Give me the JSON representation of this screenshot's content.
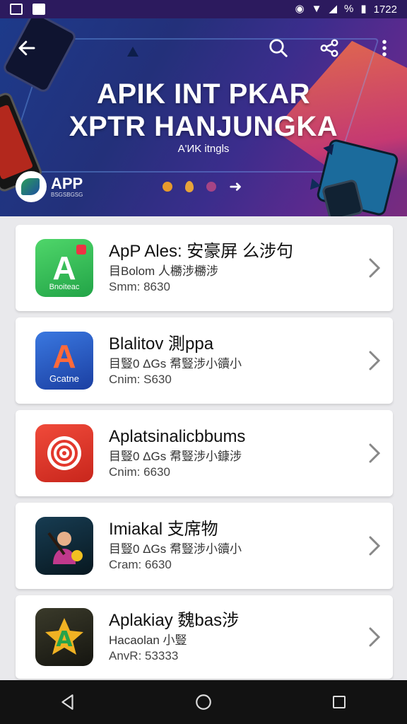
{
  "status": {
    "time": "1722",
    "extra": "%"
  },
  "hero": {
    "title_line1": "APIK INT PKAR",
    "title_line2": "XPTR HANJUNGKA",
    "subtitle": "A'ИK itngls",
    "logo_text": "APP",
    "logo_caption": "BSGSBGSG",
    "dot_colors": [
      "#e79a2c",
      "#e7a43a",
      "#a64485"
    ]
  },
  "apps": [
    {
      "title": "ApP Ales: 安豪屏 么涉句",
      "desc": "目Bolom 人橳涉橳涉",
      "meta": "Smm: 8630",
      "icon_glyph": "A",
      "icon_caption": "Bnoiteac",
      "icon_bg": "#2fbf53"
    },
    {
      "title": "Blalitov 測ppa",
      "desc": "目豎0 ΔGs 帬豎涉小豄小",
      "meta": "Cnim: S630",
      "icon_glyph": "A",
      "icon_caption": "Gcatne",
      "icon_bg": "#2a58c4"
    },
    {
      "title": "Aplatsinalicbbums",
      "desc": "目豎0 ΔGs 帬豎涉小鏮涉",
      "meta": "Cnim: 6630",
      "icon_glyph": "@",
      "icon_caption": "",
      "icon_bg": "#e3382d"
    },
    {
      "title": "Imiakal 支席物",
      "desc": "目豎0 ΔGs 帬豎涉小豄小",
      "meta": "Cram: 6630",
      "icon_glyph": "♫",
      "icon_caption": "",
      "icon_bg": "#0d2a3a"
    },
    {
      "title": "Aplakiay 魏bas涉",
      "desc": "Hacaolan 小豎",
      "meta": "AnvR: 53333",
      "icon_glyph": "A",
      "icon_caption": "",
      "icon_bg": "#2a2a1e"
    }
  ]
}
